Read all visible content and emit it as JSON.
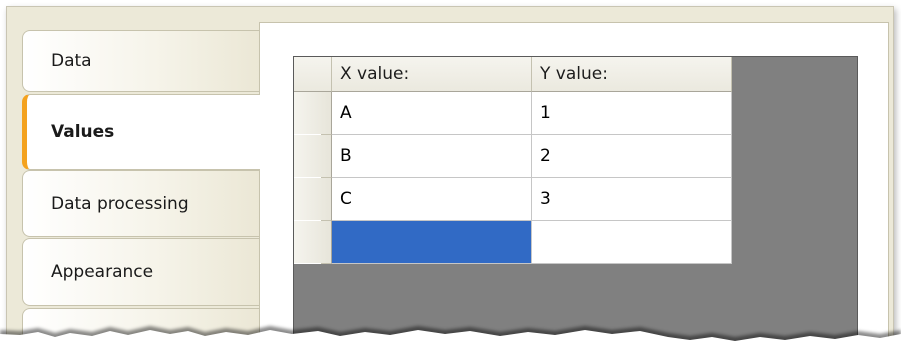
{
  "tabs": [
    {
      "label": "Data"
    },
    {
      "label": "Values"
    },
    {
      "label": "Data processing"
    },
    {
      "label": "Appearance"
    }
  ],
  "active_tab": "Values",
  "grid": {
    "columns": [
      "X value:",
      "Y value:"
    ],
    "rows": [
      [
        "A",
        "1"
      ],
      [
        "B",
        "2"
      ],
      [
        "C",
        "3"
      ],
      [
        "",
        ""
      ]
    ]
  },
  "colors": {
    "active_tab_accent": "#f4a21e",
    "selection": "#316ac5",
    "grid_background": "#808080"
  }
}
